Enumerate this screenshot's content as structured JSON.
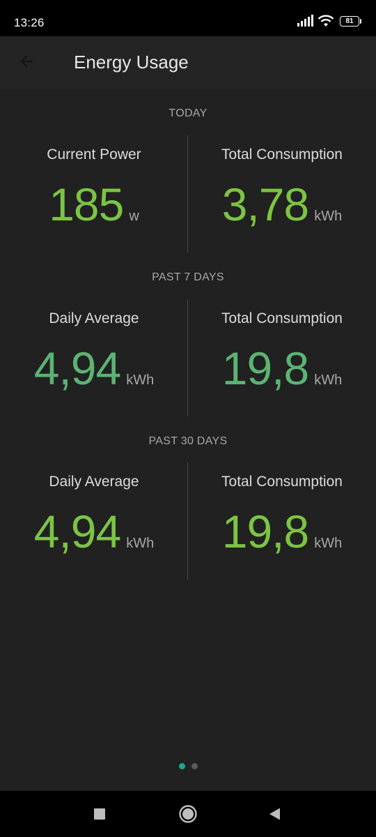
{
  "status_bar": {
    "time": "13:26",
    "battery_level": "81"
  },
  "header": {
    "title": "Energy Usage",
    "back_icon": "arrow-left-icon"
  },
  "sections": [
    {
      "title": "TODAY",
      "left": {
        "label": "Current Power",
        "value": "185",
        "unit": "w"
      },
      "right": {
        "label": "Total Consumption",
        "value": "3,78",
        "unit": "kWh"
      },
      "value_color": "#7cc444"
    },
    {
      "title": "PAST 7 DAYS",
      "left": {
        "label": "Daily Average",
        "value": "4,94",
        "unit": "kWh"
      },
      "right": {
        "label": "Total Consumption",
        "value": "19,8",
        "unit": "kWh"
      },
      "value_color": "#5cb374"
    },
    {
      "title": "PAST 30 DAYS",
      "left": {
        "label": "Daily Average",
        "value": "4,94",
        "unit": "kWh"
      },
      "right": {
        "label": "Total Consumption",
        "value": "19,8",
        "unit": "kWh"
      },
      "value_color": "#7cc444"
    }
  ],
  "page_indicator": {
    "count": 2,
    "active_index": 0,
    "active_color": "#1fa58c",
    "inactive_color": "#5a5a5a"
  },
  "nav_bar": {
    "recents_icon": "square-icon",
    "home_icon": "circle-icon",
    "back_icon": "triangle-back-icon"
  },
  "colors": {
    "background": "#212121",
    "app_bar": "#242424",
    "status_bar": "#000000"
  }
}
